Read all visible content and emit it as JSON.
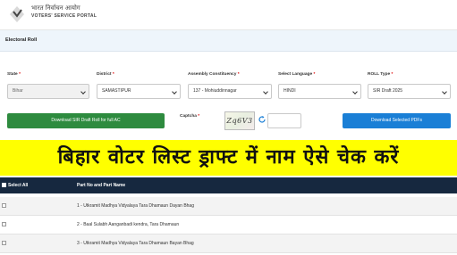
{
  "header": {
    "logo_hi": "भारत निर्वाचन आयोग",
    "logo_en": "VOTERS' SERVICE PORTAL"
  },
  "page": {
    "title": "Electoral Roll"
  },
  "form": {
    "state": {
      "label": "State",
      "value": "Bihar"
    },
    "district": {
      "label": "District",
      "value": "SAMASTIPUR"
    },
    "assembly": {
      "label": "Assembly Constituency",
      "value": "137 - Mohiuddinnagar"
    },
    "language": {
      "label": "Select Language",
      "value": "HINDI"
    },
    "roll_type": {
      "label": "ROLL Type",
      "value": "SIR Draft 2025"
    },
    "required_mark": "*",
    "captcha_label": "Captcha",
    "captcha_text": "Zq6V3",
    "download_full_label": "Download SIR Draft Roll for full AC",
    "download_selected_label": "Download Selected PDFs"
  },
  "banner": {
    "text": "बिहार वोटर लिस्ट ड्राफ्ट में नाम ऐसे चेक करें"
  },
  "table": {
    "headers": {
      "select_all": "Select All",
      "part": "Part No and Part Name"
    },
    "rows": [
      "1 - Utkramit Madhya Vidyalaya Tara Dhamaun Dayan Bhag",
      "2 - Baal Sulabh Aanganbadi kendra, Tara Dhamaun",
      "3 - Utkramit Madhya Vidyalaya Tara Dhamaun Bayan Bhag"
    ]
  },
  "colors": {
    "banner_bg": "#ffff00",
    "table_header_bg": "#16283f",
    "green_button": "#2e8b3f",
    "blue_button": "#1a7fd6"
  }
}
